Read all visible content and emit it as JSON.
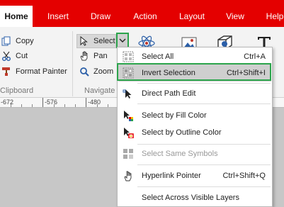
{
  "tabs": [
    "Home",
    "Insert",
    "Draw",
    "Action",
    "Layout",
    "View",
    "Help"
  ],
  "ribbon": {
    "clipboard": {
      "copy": "Copy",
      "cut": "Cut",
      "format_painter": "Format Painter",
      "label": "Clipboard"
    },
    "navigate": {
      "select": "Select",
      "pan": "Pan",
      "zoom": "Zoom",
      "label": "Navigate"
    }
  },
  "ruler": [
    "-672",
    "-576",
    "-480"
  ],
  "menu": {
    "items": [
      {
        "label": "Select All",
        "shortcut": "Ctrl+A",
        "icon": "select-all-icon"
      },
      {
        "label": "Invert Selection",
        "shortcut": "Ctrl+Shift+I",
        "icon": "invert-selection-icon"
      },
      {
        "label": "Direct Path Edit",
        "shortcut": "",
        "icon": "direct-path-edit-icon"
      },
      {
        "label": "Select by Fill Color",
        "shortcut": "",
        "icon": "fill-color-icon"
      },
      {
        "label": "Select by Outline Color",
        "shortcut": "",
        "icon": "outline-color-icon"
      },
      {
        "label": "Select Same Symbols",
        "shortcut": "",
        "icon": "same-symbols-icon"
      },
      {
        "label": "Hyperlink Pointer",
        "shortcut": "Ctrl+Shift+Q",
        "icon": "hyperlink-pointer-icon"
      },
      {
        "label": "Select Across Visible Layers",
        "shortcut": "",
        "icon": ""
      }
    ]
  },
  "colors": {
    "accent_red": "#e40000",
    "highlight_green": "#2ca44c"
  }
}
